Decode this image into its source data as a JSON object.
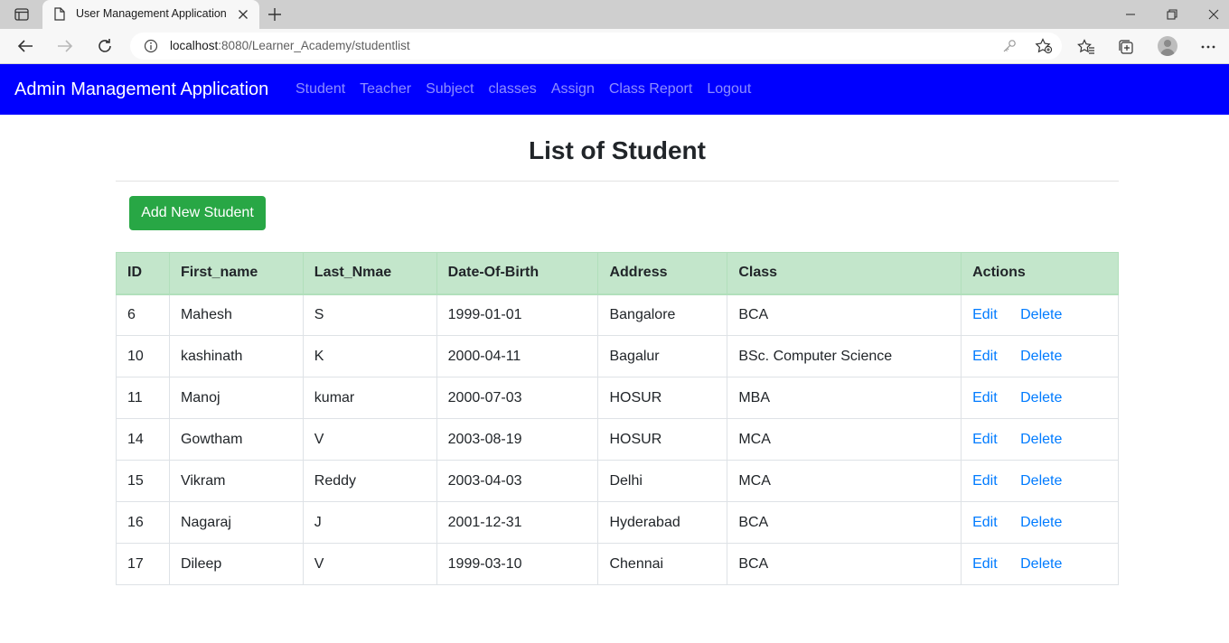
{
  "browser": {
    "tab_title": "User Management Application",
    "url_host": "localhost",
    "url_rest": ":8080/Learner_Academy/studentlist"
  },
  "navbar": {
    "brand": "Admin Management Application",
    "links": [
      "Student",
      "Teacher",
      "Subject",
      "classes",
      "Assign",
      "Class Report",
      "Logout"
    ],
    "background": "#0000ff"
  },
  "page": {
    "title": "List of Student",
    "add_button": "Add New Student"
  },
  "table": {
    "headers": [
      "ID",
      "First_name",
      "Last_Nmae",
      "Date-Of-Birth",
      "Address",
      "Class",
      "Actions"
    ],
    "edit_label": "Edit",
    "delete_label": "Delete",
    "rows": [
      [
        "6",
        "Mahesh",
        "S",
        "1999-01-01",
        "Bangalore",
        "BCA"
      ],
      [
        "10",
        "kashinath",
        "K",
        "2000-04-11",
        "Bagalur",
        "BSc. Computer Science"
      ],
      [
        "11",
        "Manoj",
        "kumar",
        "2000-07-03",
        "HOSUR",
        "MBA"
      ],
      [
        "14",
        "Gowtham",
        "V",
        "2003-08-19",
        "HOSUR",
        "MCA"
      ],
      [
        "15",
        "Vikram",
        "Reddy",
        "2003-04-03",
        "Delhi",
        "MCA"
      ],
      [
        "16",
        "Nagaraj",
        "J",
        "2001-12-31",
        "Hyderabad",
        "BCA"
      ],
      [
        "17",
        "Dileep",
        "V",
        "1999-03-10",
        "Chennai",
        "BCA"
      ]
    ]
  },
  "colors": {
    "header_row": "#c3e6cb",
    "add_button": "#28a745",
    "action_link": "#007bff"
  }
}
